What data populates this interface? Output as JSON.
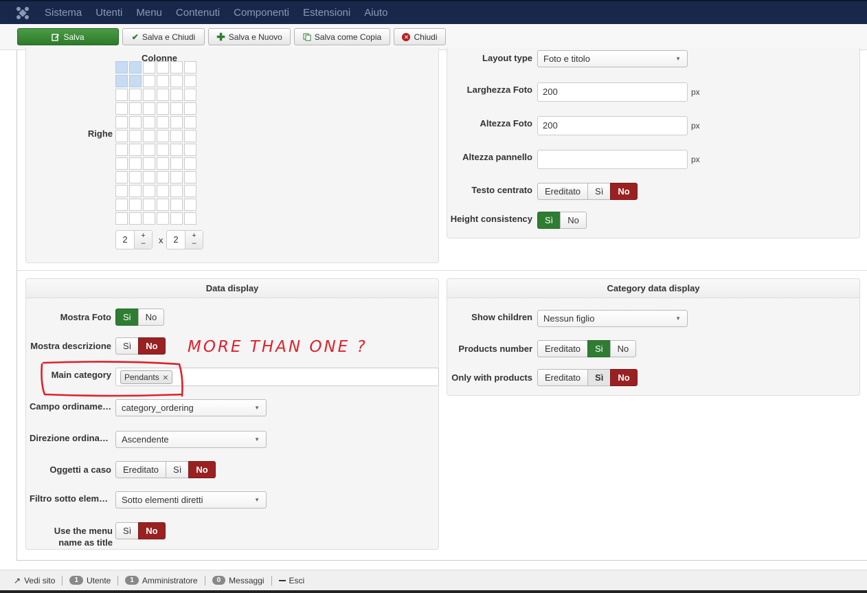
{
  "topbar": {
    "menu": [
      "Sistema",
      "Utenti",
      "Menu",
      "Contenuti",
      "Componenti",
      "Estensioni",
      "Aiuto"
    ],
    "bar_color": "#17284a"
  },
  "toolbar": {
    "save": "Salva",
    "save_close": "Salva e Chiudi",
    "save_new": "Salva e Nuovo",
    "save_copy": "Salva come Copia",
    "close": "Chiudi"
  },
  "grid_panel": {
    "columns_label": "Colonne",
    "rows_label": "Righe",
    "cols_value": "2",
    "rows_value": "2",
    "times": "x",
    "plus": "+",
    "minus": "–"
  },
  "layout_panel": {
    "layout_type_label": "Layout type",
    "layout_type_value": "Foto e titolo",
    "width_label": "Larghezza Foto",
    "width_value": "200",
    "height_label": "Altezza Foto",
    "height_value": "200",
    "panel_height_label": "Altezza pannello",
    "panel_height_value": "",
    "unit": "px",
    "centered_label": "Testo centrato",
    "height_consistency_label": "Height consistency"
  },
  "data_display": {
    "title": "Data display",
    "show_photo_label": "Mostra Foto",
    "show_desc_label": "Mostra descrizione",
    "main_category_label": "Main category",
    "main_category_tag": "Pendants",
    "tag_remove": "×",
    "ordering_field_label": "Campo ordiname…",
    "ordering_field_value": "category_ordering",
    "ordering_dir_label": "Direzione ordina…",
    "ordering_dir_value": "Ascendente",
    "random_label": "Oggetti a caso",
    "sub_filter_label": "Filtro sotto elem…",
    "sub_filter_value": "Sotto elementi diretti",
    "menu_name_label_1": "Use the menu",
    "menu_name_label_2": "name as title"
  },
  "category_display": {
    "title": "Category data display",
    "show_children_label": "Show children",
    "show_children_value": "Nessun figlio",
    "products_number_label": "Products number",
    "only_products_label": "Only with products"
  },
  "toggles": {
    "inherited": "Ereditato",
    "yes": "Si",
    "yes_alt": "Sì",
    "no": "No"
  },
  "annotation": {
    "text": "MORE THAN ONE ?",
    "color": "#e0202a"
  },
  "footer": {
    "view_site": "Vedi sito",
    "users_count": "1",
    "users_label": "Utente",
    "admins_count": "1",
    "admins_label": "Amministratore",
    "messages_count": "0",
    "messages_label": "Messaggi",
    "logout": "Esci"
  },
  "colors": {
    "green": "#2f7d32",
    "red": "#9a2121"
  }
}
